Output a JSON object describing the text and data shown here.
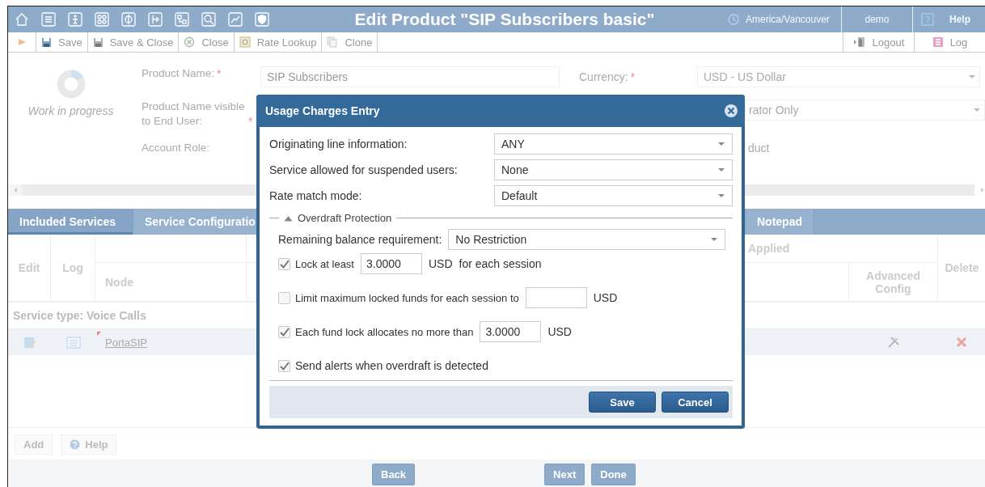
{
  "header": {
    "title": "Edit Product \"SIP Subscribers basic\"",
    "timezone": "America/Vancouver",
    "user": "demo",
    "help": "Help"
  },
  "toolbar": {
    "buttons": [
      {
        "kind": "run"
      },
      {
        "kind": "save",
        "label": "Save"
      },
      {
        "kind": "save-close",
        "label": "Save & Close"
      },
      {
        "kind": "close",
        "label": "Close"
      },
      {
        "kind": "lookup",
        "label": "Rate Lookup"
      },
      {
        "kind": "clone",
        "label": "Clone"
      }
    ],
    "right_buttons": [
      {
        "kind": "logout",
        "label": "Logout"
      },
      {
        "kind": "log",
        "label": "Log"
      }
    ]
  },
  "form": {
    "status": "Work in progress",
    "rows": [
      {
        "label": "Product Name:",
        "mark": "*",
        "value": "SIP Subscribers",
        "right_field": {
          "kind": "select",
          "label": "Currency:",
          "mark": "*",
          "value": "USD - US Dollar"
        }
      },
      {
        "label": "Product Name visible to End User:",
        "mark": "*",
        "right_field": {
          "kind": "select",
          "value": "rator Only"
        }
      },
      {
        "label": "Account Role:",
        "right_field": {
          "kind": "text",
          "value": "duct"
        }
      }
    ]
  },
  "tabs": [
    {
      "label": "Included Services",
      "selected": true
    },
    {
      "label": "Service Configuratio",
      "selected": false
    },
    {
      "label": "Notepad",
      "selected": false
    }
  ],
  "table": {
    "columns": [
      "Edit",
      "Log",
      "Node"
    ],
    "group_header": "Applied",
    "right_columns": [
      "Advanced Config",
      "Delete"
    ],
    "groups": [
      {
        "title": "Service type: Voice Calls",
        "rows": [
          {
            "node": "PortaSIP",
            "flagged": true
          }
        ]
      }
    ]
  },
  "actions": [
    {
      "kind": "add",
      "label": "Add"
    },
    {
      "kind": "help",
      "label": "Help"
    }
  ],
  "wizard_buttons": [
    "Back",
    "Next",
    "Done"
  ],
  "dialog": {
    "title": "Usage Charges Entry",
    "fields": [
      {
        "label": "Originating line information:",
        "value": "ANY"
      },
      {
        "label": "Service allowed for suspended users:",
        "value": "None"
      },
      {
        "label": "Rate match mode:",
        "value": "Default"
      }
    ],
    "section": {
      "title": "Overdraft Protection",
      "expanded": true,
      "balance": {
        "label": "Remaining balance requirement:",
        "value": "No Restriction"
      },
      "options": [
        {
          "label": "Lock at least",
          "checked": true,
          "value": "3.0000",
          "unit": "USD",
          "suffix": "for each session"
        },
        {
          "label": "Limit maximum locked funds for each session to",
          "checked": false,
          "unit": "USD"
        },
        {
          "label": "Each fund lock allocates no more than",
          "checked": true,
          "value": "3.0000",
          "unit": "USD"
        },
        {
          "label": "Send alerts when overdraft is detected",
          "checked": true
        }
      ]
    },
    "buttons": [
      "Save",
      "Cancel"
    ]
  }
}
